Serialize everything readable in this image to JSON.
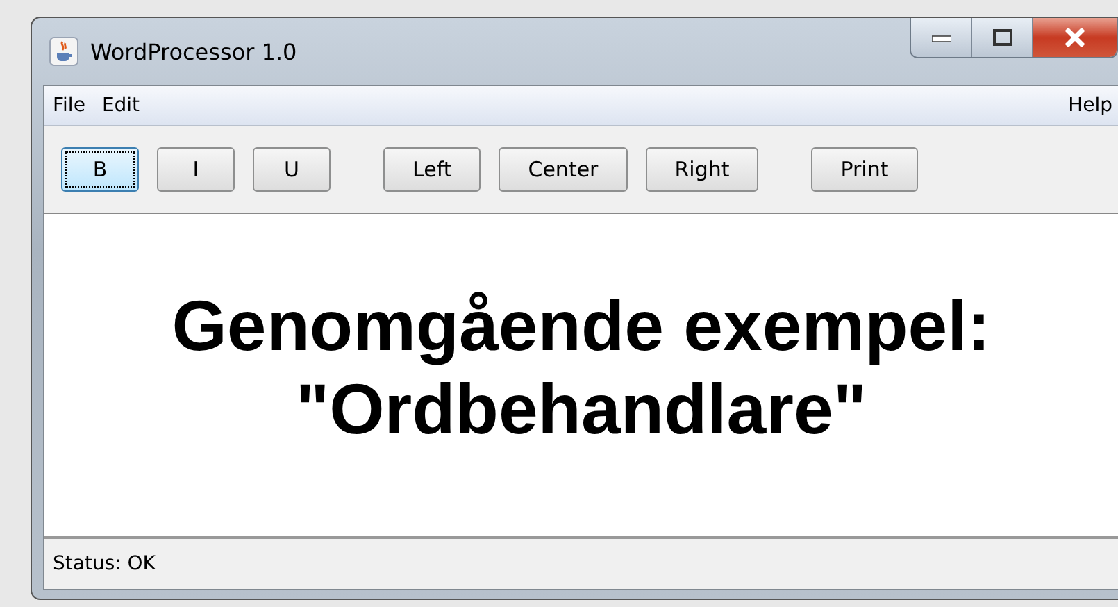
{
  "window": {
    "title": "WordProcessor 1.0"
  },
  "menu": {
    "left": [
      "File",
      "Edit"
    ],
    "right": [
      "Help"
    ]
  },
  "toolbar": [
    [
      {
        "label": "B",
        "focused": true
      },
      {
        "label": "I",
        "focused": false
      },
      {
        "label": "U",
        "focused": false
      }
    ],
    [
      {
        "label": "Left",
        "focused": false
      },
      {
        "label": "Center",
        "focused": false
      },
      {
        "label": "Right",
        "focused": false
      }
    ],
    [
      {
        "label": "Print",
        "focused": false
      }
    ]
  ],
  "document": {
    "lines": [
      "Genomgående exempel:",
      "\"Ordbehandlare\""
    ]
  },
  "status_bar": "Status: OK"
}
